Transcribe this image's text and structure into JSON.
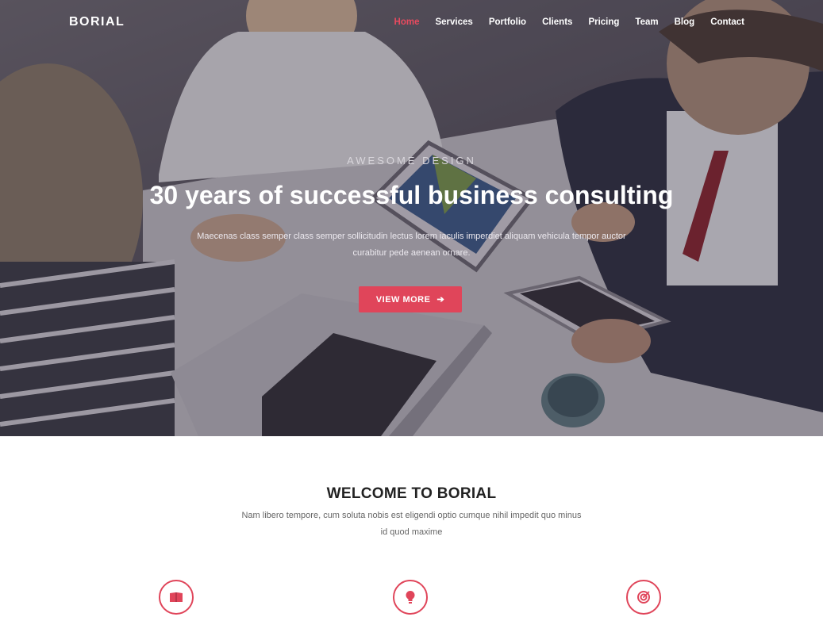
{
  "brand": "BORIAL",
  "nav": {
    "items": [
      {
        "label": "Home",
        "active": true
      },
      {
        "label": "Services",
        "active": false
      },
      {
        "label": "Portfolio",
        "active": false
      },
      {
        "label": "Clients",
        "active": false
      },
      {
        "label": "Pricing",
        "active": false
      },
      {
        "label": "Team",
        "active": false
      },
      {
        "label": "Blog",
        "active": false
      },
      {
        "label": "Contact",
        "active": false
      }
    ]
  },
  "hero": {
    "eyebrow": "AWESOME DESIGN",
    "title": "30 years of successful business consulting",
    "text": "Maecenas class semper class semper sollicitudin lectus lorem iaculis imperdiet aliquam vehicula tempor auctor curabitur pede aenean ornare.",
    "button_label": "VIEW MORE",
    "button_icon": "arrow-right-icon"
  },
  "welcome": {
    "title": "WELCOME TO BORIAL",
    "text": "Nam libero tempore, cum soluta nobis est eligendi optio cumque nihil impedit quo minus id quod maxime"
  },
  "features": [
    {
      "icon": "book-icon"
    },
    {
      "icon": "lightbulb-icon"
    },
    {
      "icon": "target-icon"
    }
  ],
  "colors": {
    "accent": "#e0455a",
    "active_nav": "#e84a5f"
  }
}
